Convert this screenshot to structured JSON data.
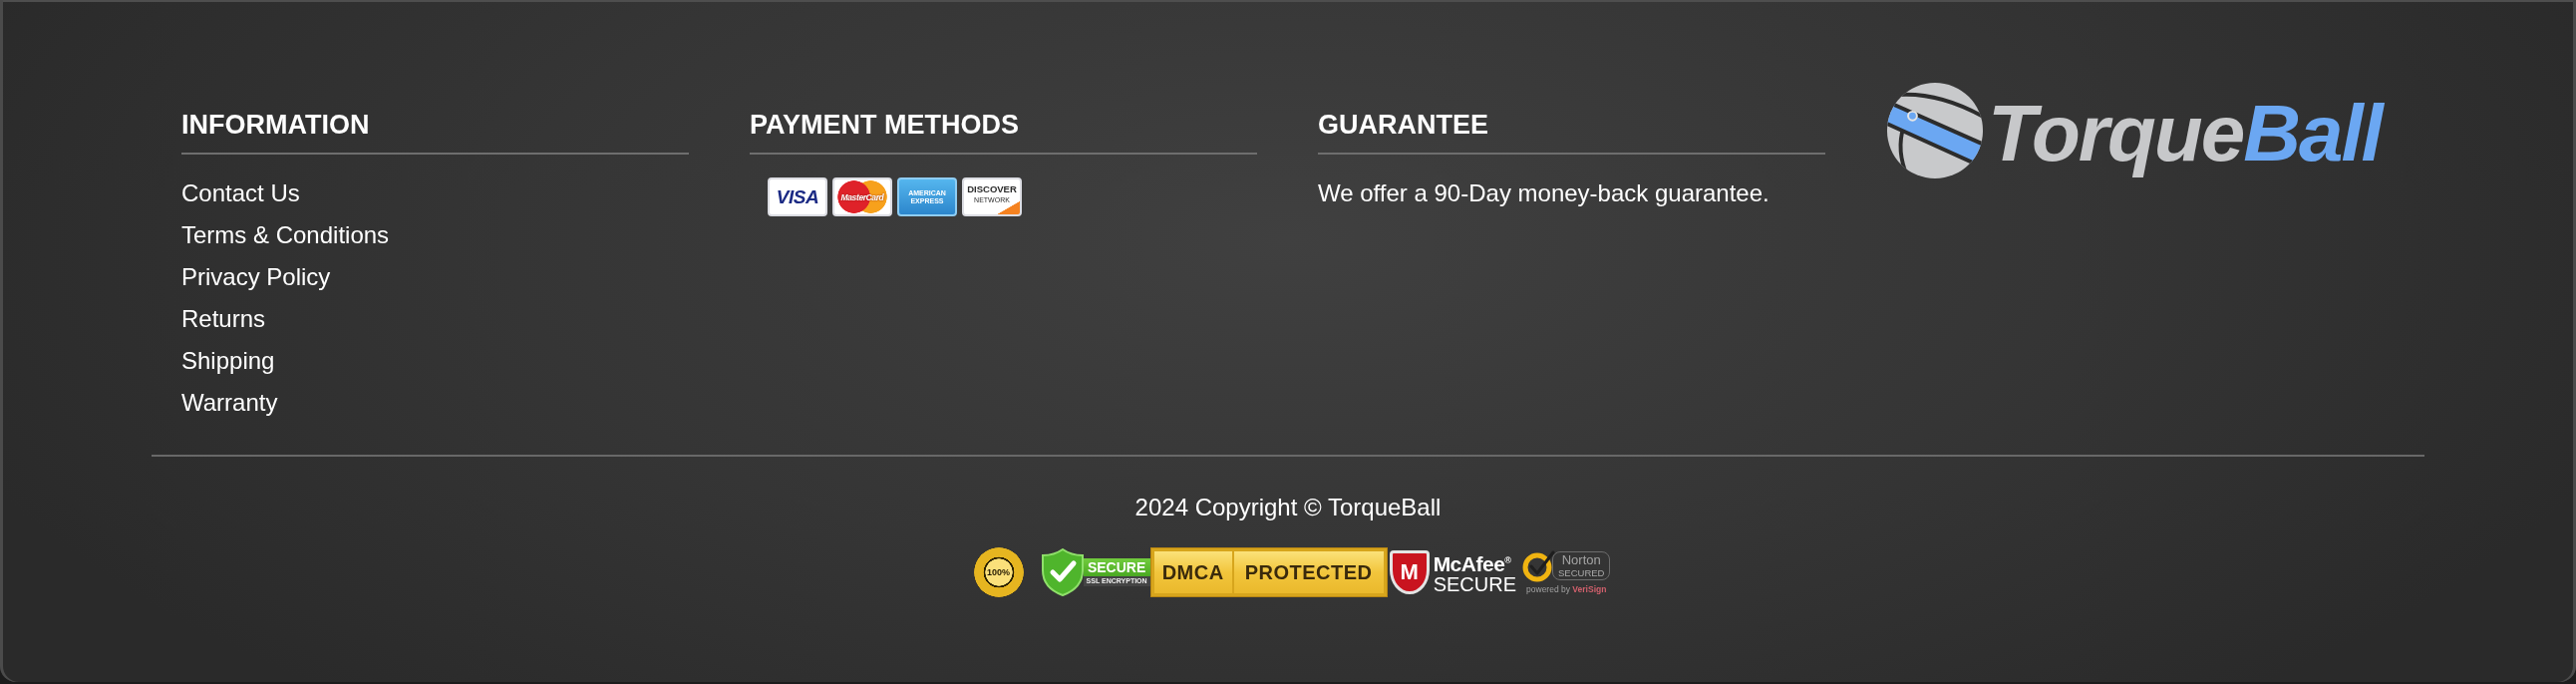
{
  "columns": [
    {
      "kind": "links",
      "heading": "INFORMATION",
      "links": [
        "Contact Us",
        "Terms & Conditions",
        "Privacy Policy",
        "Returns",
        "Shipping",
        "Warranty"
      ]
    },
    {
      "kind": "cards",
      "heading": "PAYMENT METHODS",
      "cards": [
        {
          "kind": "visa",
          "text": "VISA"
        },
        {
          "kind": "mastercard",
          "text": "MasterCard"
        },
        {
          "kind": "amex",
          "text": "AMERICAN EXPRESS"
        },
        {
          "kind": "discover",
          "text": "DISCOVER",
          "subtext": "NETWORK"
        }
      ]
    },
    {
      "kind": "text",
      "heading": "GUARANTEE",
      "text": "We offer a 90-Day money-back guarantee."
    }
  ],
  "logo": {
    "first": "Torque",
    "second": "Ball"
  },
  "copyright": "2024 Copyright © TorqueBall",
  "badges": [
    {
      "kind": "seal",
      "text": "100%"
    },
    {
      "kind": "ssl",
      "title": "SECURE",
      "subtitle": "SSL ENCRYPTION"
    },
    {
      "kind": "dmca",
      "left": "DMCA",
      "right": "PROTECTED"
    },
    {
      "kind": "mcafee",
      "mark": "M",
      "title": "McAfee$^{®}$",
      "subtitle": "SECURE"
    },
    {
      "kind": "norton",
      "title": "Norton",
      "subtitle": "SECURED",
      "footer": "powered by **VeriSign**"
    }
  ]
}
